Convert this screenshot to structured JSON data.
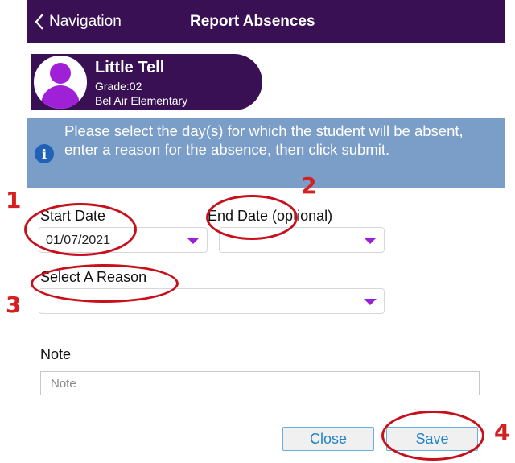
{
  "header": {
    "back_label": "Navigation",
    "title": "Report Absences",
    "bar_color": "#3a1054"
  },
  "student": {
    "name": "Little Tell",
    "grade": "Grade:02",
    "school": "Bel Air Elementary",
    "avatar_icon": "person-icon",
    "avatar_color": "#a020d8"
  },
  "info_banner": {
    "icon": "info-icon",
    "text": "Please select the day(s) for which the student will be absent, enter a reason for the absence, then click submit.",
    "color": "#7b9ec9"
  },
  "form": {
    "start_date_label": "Start Date",
    "start_date_value": "01/07/2021",
    "end_date_label": "End Date (optional)",
    "end_date_value": "",
    "reason_label": "Select A Reason",
    "reason_value": "",
    "note_label": "Note",
    "note_placeholder": "Note",
    "dropdown_caret_color": "#9a1fd6"
  },
  "buttons": {
    "close_label": "Close",
    "save_label": "Save",
    "text_color": "#2383c8"
  },
  "annotations": {
    "color": "#c8101c",
    "markers": [
      "1",
      "2",
      "3",
      "4"
    ]
  }
}
